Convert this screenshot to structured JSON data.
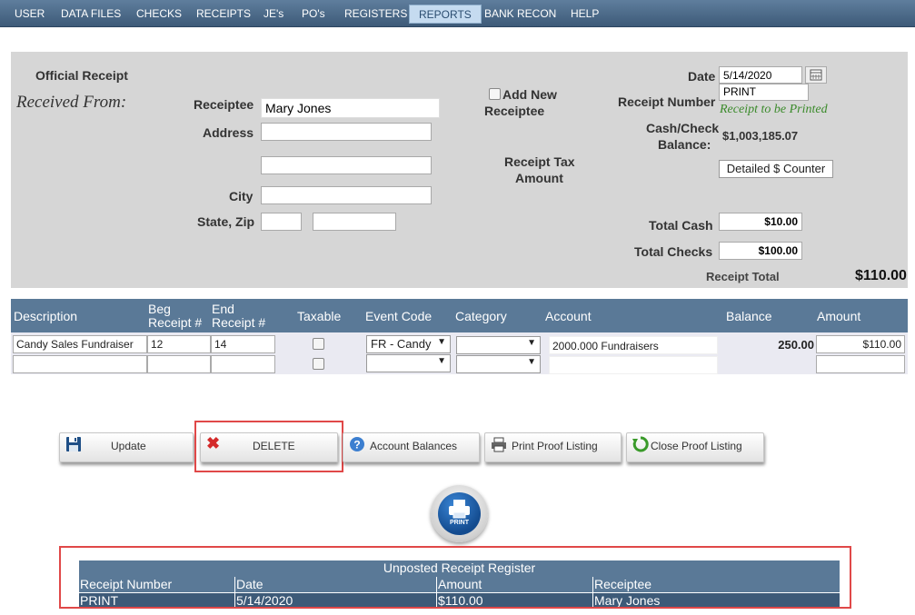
{
  "menu": {
    "items": [
      {
        "label": "USER"
      },
      {
        "label": "DATA FILES"
      },
      {
        "label": "CHECKS"
      },
      {
        "label": "RECEIPTS"
      },
      {
        "label": "JE's"
      },
      {
        "label": "PO's"
      },
      {
        "label": "REGISTERS"
      },
      {
        "label": "REPORTS"
      },
      {
        "label": "BANK RECON"
      },
      {
        "label": "HELP"
      }
    ]
  },
  "form": {
    "official_receipt": "Official Receipt",
    "received_from": "Received From:",
    "receipt_label": "Receiptee",
    "receiptee_value": "Mary Jones",
    "address_label": "Address",
    "address1": "",
    "address2": "",
    "city_label": "City",
    "city_value": "",
    "state_zip_label": "State, Zip",
    "state_value": "",
    "zip_value": "",
    "add_new_label": "Add New",
    "add_new_label2": "Receiptee",
    "tax_label": "Receipt Tax",
    "tax_label2": "Amount",
    "date_label": "Date",
    "date_value": "5/14/2020",
    "receipt_number_label": "Receipt Number",
    "receipt_number_value": "PRINT",
    "receipt_note": "Receipt to be Printed",
    "balance_label": "Cash/Check",
    "balance_label2": "Balance:",
    "balance_value": "$1,003,185.07",
    "detailed_counter": "Detailed $ Counter",
    "total_cash_label": "Total Cash",
    "total_cash_value": "$10.00",
    "total_checks_label": "Total Checks",
    "total_checks_value": "$100.00",
    "receipt_total_label": "Receipt Total",
    "receipt_total_value": "$110.00"
  },
  "grid": {
    "headers": {
      "description": "Description",
      "beg1": "Beg",
      "beg2": "Receipt #",
      "end1": "End",
      "end2": "Receipt #",
      "taxable": "Taxable",
      "event_code": "Event Code",
      "category": "Category",
      "account": "Account",
      "balance": "Balance",
      "amount": "Amount"
    },
    "rows": [
      {
        "description": "Candy Sales Fundraiser",
        "beg": "12",
        "end": "14",
        "event_code": "FR - Candy",
        "category": "",
        "account": "2000.000 Fundraisers",
        "balance": "250.00",
        "amount": "$110.00"
      },
      {
        "description": "",
        "beg": "",
        "end": "",
        "event_code": "",
        "category": "",
        "account": "",
        "balance": "",
        "amount": ""
      }
    ]
  },
  "toolbar": {
    "update": "Update",
    "delete": "DELETE",
    "account_balances": "Account Balances",
    "print_proof": "Print Proof Listing",
    "close_proof": "Close Proof Listing",
    "print": "PRINT"
  },
  "register": {
    "title": "Unposted Receipt Register",
    "columns": [
      "Receipt Number",
      "Date",
      "Amount",
      "Receiptee"
    ],
    "rows": [
      [
        "PRINT",
        "5/14/2020",
        "$110.00",
        "Mary Jones"
      ]
    ]
  },
  "colors": {
    "menubar": "#4a6a8a",
    "header": "#5a7997",
    "highlight": "#e04848"
  }
}
